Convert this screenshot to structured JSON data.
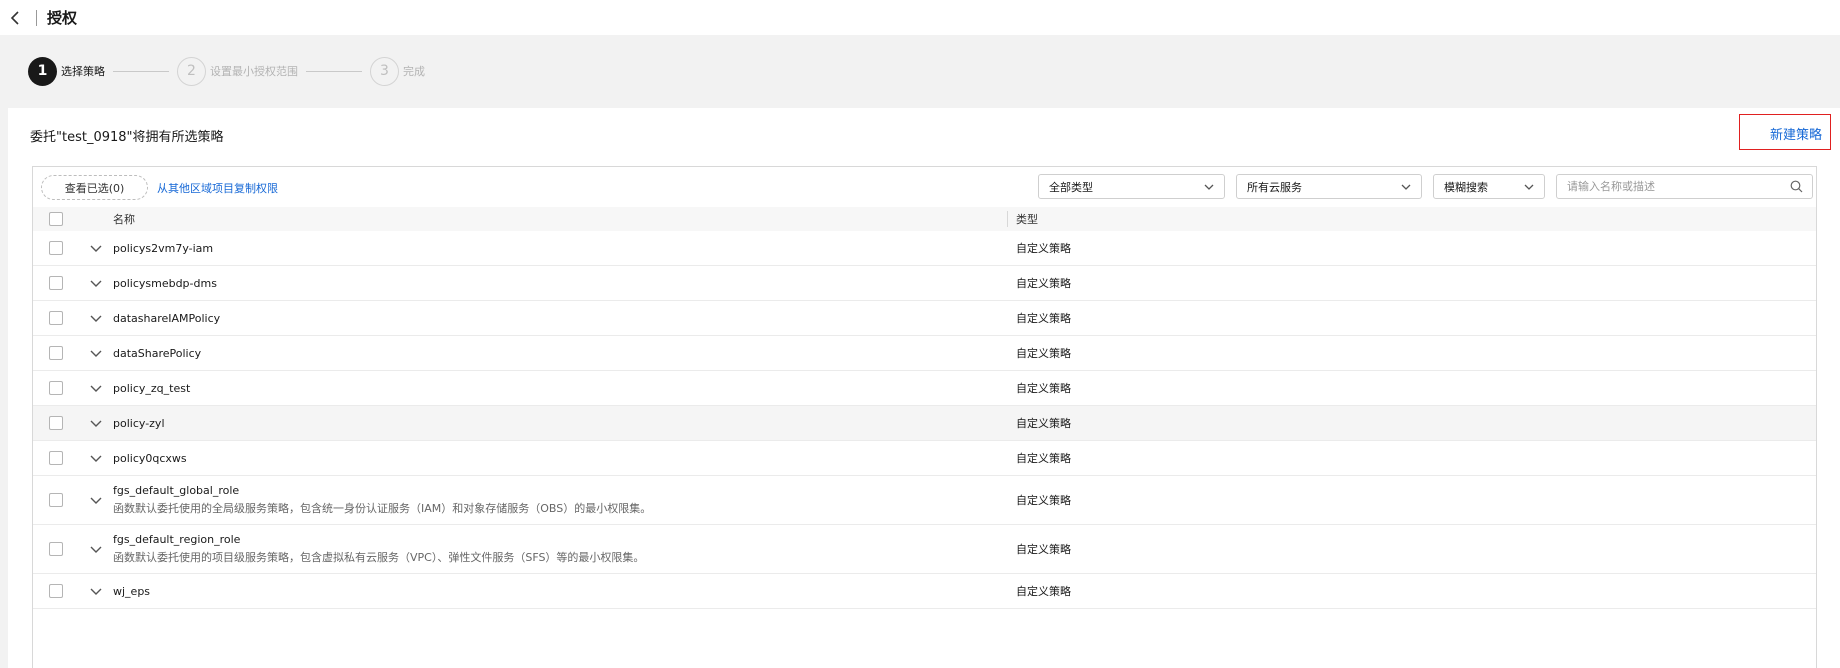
{
  "header": {
    "title": "授权"
  },
  "steps": [
    {
      "num": "1",
      "label": "选择策略"
    },
    {
      "num": "2",
      "label": "设置最小授权范围"
    },
    {
      "num": "3",
      "label": "完成"
    }
  ],
  "panel": {
    "description": "委托\"test_0918\"将拥有所选策略",
    "new_policy_label": "新建策略"
  },
  "toolbar": {
    "view_selected_label": "查看已选(0)",
    "copy_link_label": "从其他区域项目复制权限",
    "type_filter": "全部类型",
    "service_filter": "所有云服务",
    "search_mode": "模糊搜索",
    "search_placeholder": "请输入名称或描述"
  },
  "table": {
    "columns": {
      "name": "名称",
      "type": "类型"
    },
    "rows": [
      {
        "name": "policys2vm7y-iam",
        "desc": "",
        "type": "自定义策略"
      },
      {
        "name": "policysmebdp-dms",
        "desc": "",
        "type": "自定义策略"
      },
      {
        "name": "datashareIAMPolicy",
        "desc": "",
        "type": "自定义策略"
      },
      {
        "name": "dataSharePolicy",
        "desc": "",
        "type": "自定义策略"
      },
      {
        "name": "policy_zq_test",
        "desc": "",
        "type": "自定义策略"
      },
      {
        "name": "policy-zyl",
        "desc": "",
        "type": "自定义策略"
      },
      {
        "name": "policy0qcxws",
        "desc": "",
        "type": "自定义策略"
      },
      {
        "name": "fgs_default_global_role",
        "desc": "函数默认委托使用的全局级服务策略，包含统一身份认证服务（IAM）和对象存储服务（OBS）的最小权限集。",
        "type": "自定义策略"
      },
      {
        "name": "fgs_default_region_role",
        "desc": "函数默认委托使用的项目级服务策略，包含虚拟私有云服务（VPC）、弹性文件服务（SFS）等的最小权限集。",
        "type": "自定义策略"
      },
      {
        "name": "wj_eps",
        "desc": "",
        "type": "自定义策略"
      }
    ]
  },
  "colors": {
    "link": "#1668d6",
    "highlight_border": "#e02020",
    "active_step": "#191919"
  },
  "icons": [
    "back-arrow-icon",
    "chevron-down-icon",
    "search-icon",
    "expand-chevron-icon"
  ]
}
